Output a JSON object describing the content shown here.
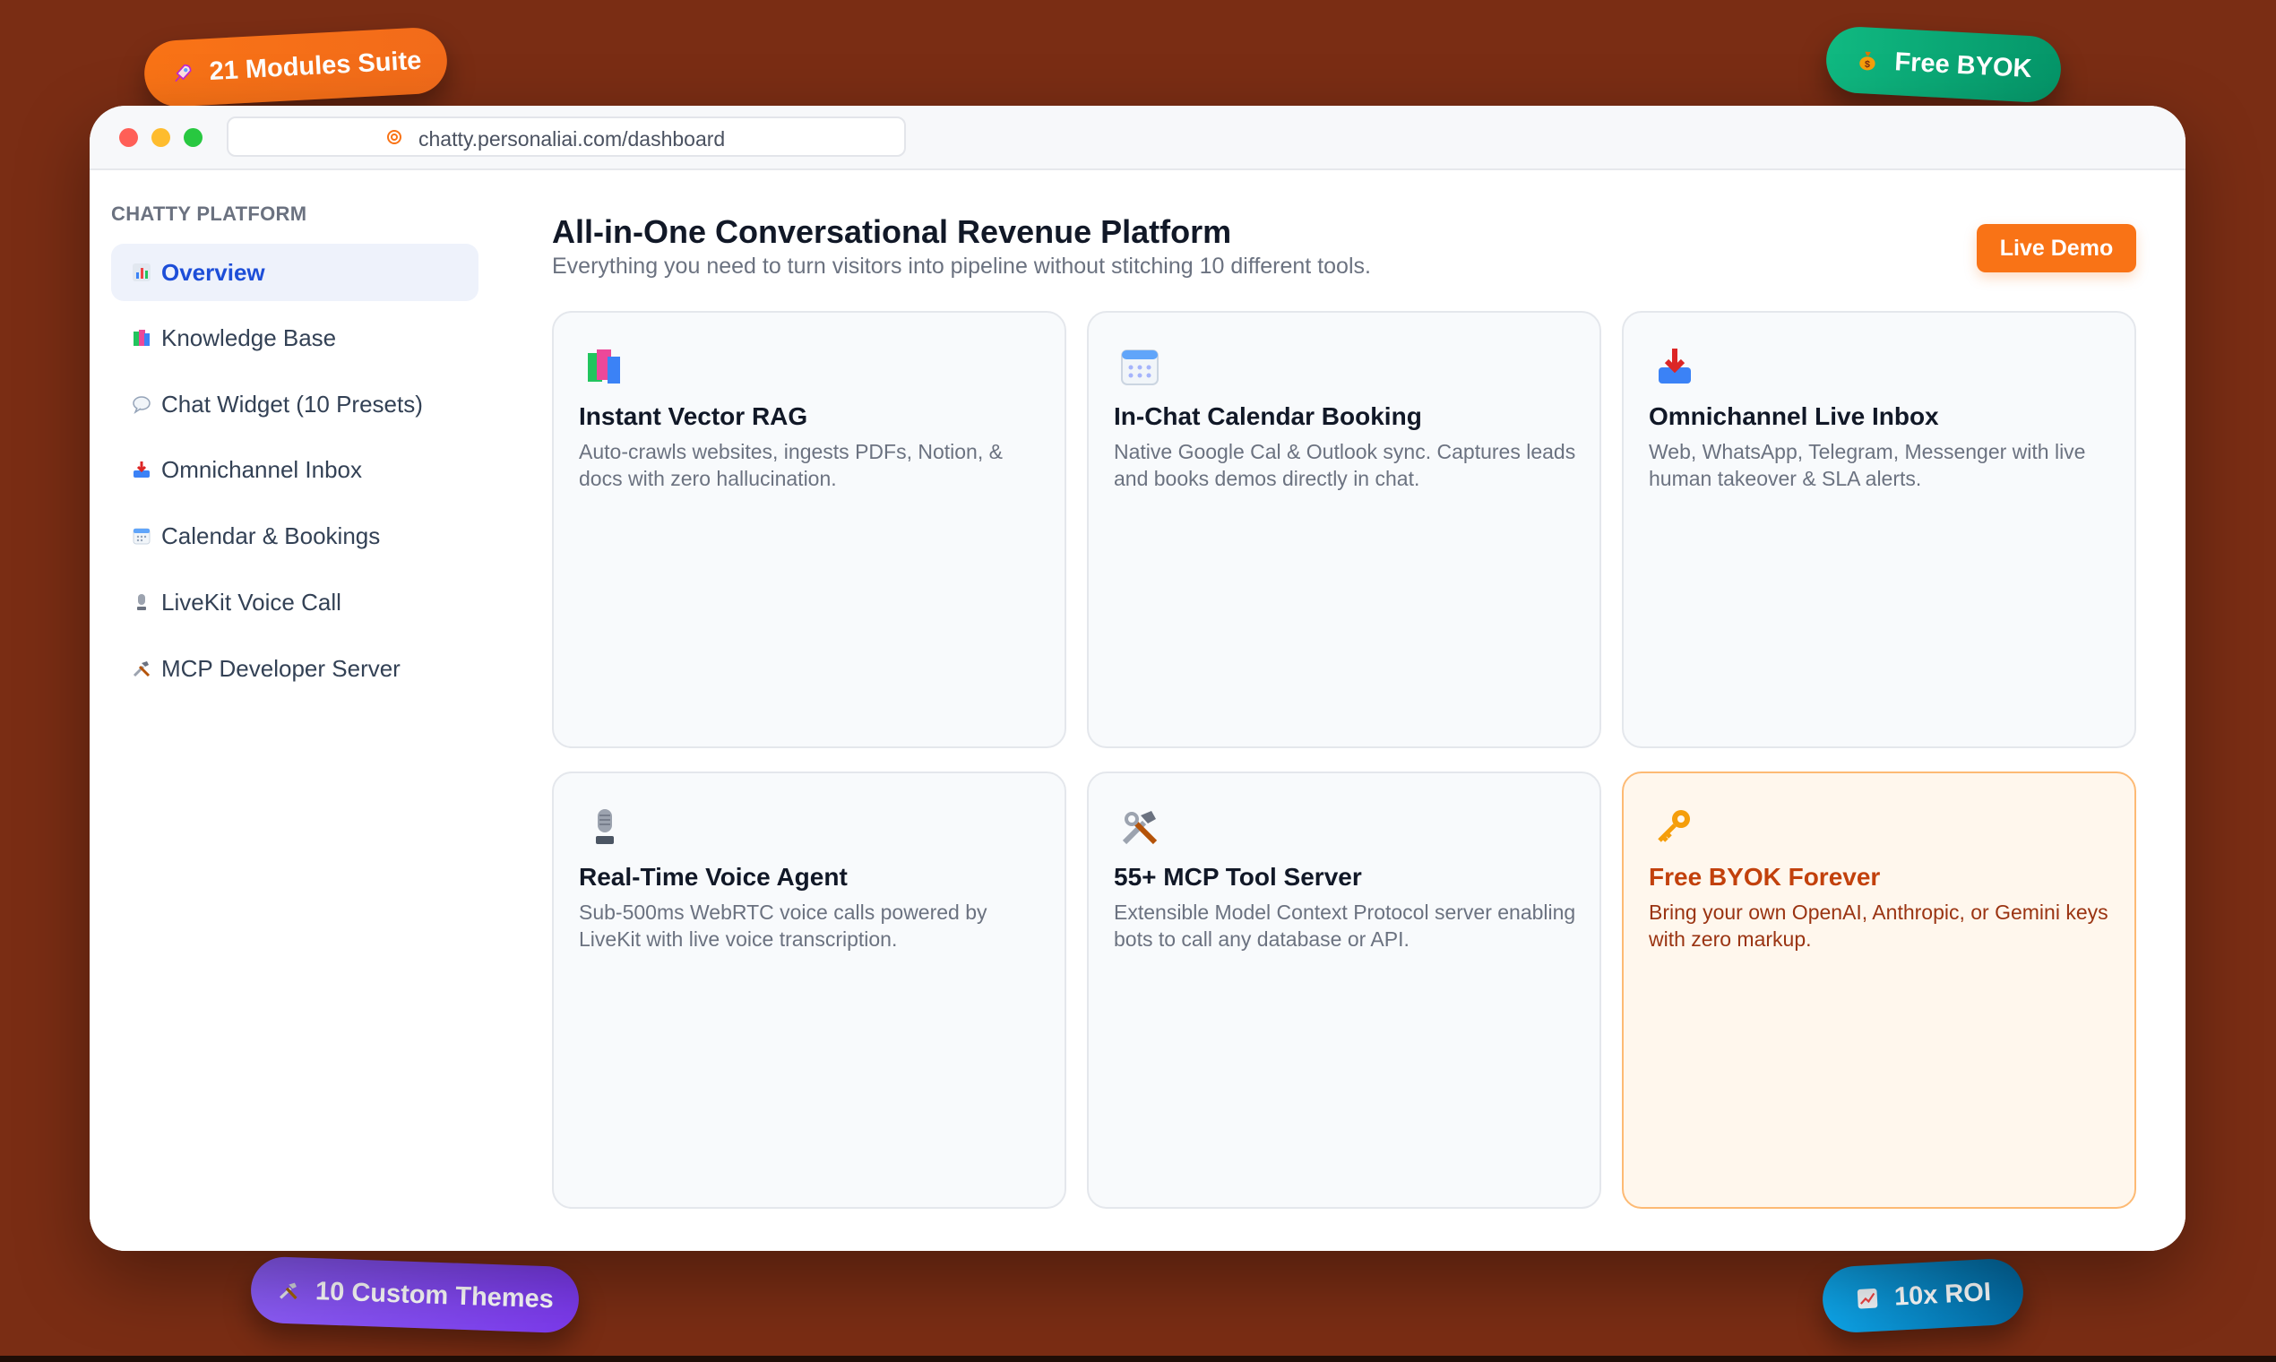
{
  "browser": {
    "url": "chatty.personaliai.com/dashboard"
  },
  "sidebar": {
    "title": "CHATTY PLATFORM",
    "items": [
      {
        "label": "Overview",
        "icon": "bar-chart-icon",
        "active": true
      },
      {
        "label": "Knowledge Base",
        "icon": "books-icon",
        "active": false
      },
      {
        "label": "Chat Widget (10 Presets)",
        "icon": "speech-bubble-icon",
        "active": false
      },
      {
        "label": "Omnichannel Inbox",
        "icon": "inbox-tray-icon",
        "active": false
      },
      {
        "label": "Calendar & Bookings",
        "icon": "calendar-icon",
        "active": false
      },
      {
        "label": "LiveKit Voice Call",
        "icon": "microphone-icon",
        "active": false
      },
      {
        "label": "MCP Developer Server",
        "icon": "hammer-wrench-icon",
        "active": false
      }
    ]
  },
  "main": {
    "title": "All-in-One Conversational Revenue Platform",
    "subtitle": "Everything you need to turn visitors into pipeline without stitching 10 different tools.",
    "live_demo_label": "Live Demo",
    "cards": [
      {
        "icon": "books-icon",
        "title": "Instant Vector RAG",
        "description": "Auto-crawls websites, ingests PDFs, Notion, & docs with zero hallucination."
      },
      {
        "icon": "calendar-icon",
        "title": "In-Chat Calendar Booking",
        "description": "Native Google Cal & Outlook sync. Captures leads and books demos directly in chat."
      },
      {
        "icon": "inbox-tray-icon",
        "title": "Omnichannel Live Inbox",
        "description": "Web, WhatsApp, Telegram, Messenger with live human takeover & SLA alerts."
      },
      {
        "icon": "microphone-icon",
        "title": "Real-Time Voice Agent",
        "description": "Sub-500ms WebRTC voice calls powered by LiveKit with live voice transcription."
      },
      {
        "icon": "hammer-wrench-icon",
        "title": "55+ MCP Tool Server",
        "description": "Extensible Model Context Protocol server enabling bots to call any database or API."
      },
      {
        "icon": "key-icon",
        "title": "Free BYOK Forever",
        "description": "Bring your own OpenAI, Anthropic, or Gemini keys with zero markup."
      }
    ]
  },
  "badges": {
    "modules": {
      "label": "21 Modules Suite",
      "icon": "rocket-icon"
    },
    "byok": {
      "label": "Free BYOK",
      "icon": "money-bag-icon"
    },
    "themes": {
      "label": "10 Custom Themes",
      "icon": "hammer-wrench-icon"
    },
    "roi": {
      "label": "10x ROI",
      "icon": "chart-up-icon"
    }
  },
  "colors": {
    "background": "#7a2d14",
    "accent_orange": "#f97316",
    "active_nav": "#1d4ed8",
    "badge_green": "#10b981",
    "badge_purple": "#8b5cf6",
    "badge_blue": "#0ea5e9"
  }
}
